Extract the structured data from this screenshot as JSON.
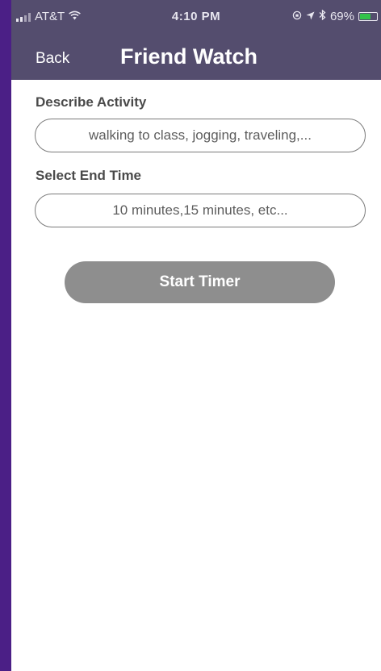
{
  "status_bar": {
    "carrier": "AT&T",
    "time": "4:10 PM",
    "battery_percent": "69%",
    "battery_level": 0.69,
    "icons": [
      "signal-icon",
      "wifi-icon",
      "orientation-lock-icon",
      "location-icon",
      "bluetooth-icon",
      "battery-icon"
    ],
    "battery_color": "#33c24a"
  },
  "nav": {
    "back_label": "Back",
    "title": "Friend Watch",
    "bar_color": "#544d6e"
  },
  "form": {
    "activity_label": "Describe Activity",
    "activity_placeholder": "walking to class, jogging, traveling,...",
    "end_time_label": "Select End Time",
    "end_time_placeholder": "10 minutes,15 minutes, etc..."
  },
  "actions": {
    "start_label": "Start Timer",
    "start_color": "#8e8e8e"
  },
  "theme": {
    "background": "#4b1f86"
  }
}
